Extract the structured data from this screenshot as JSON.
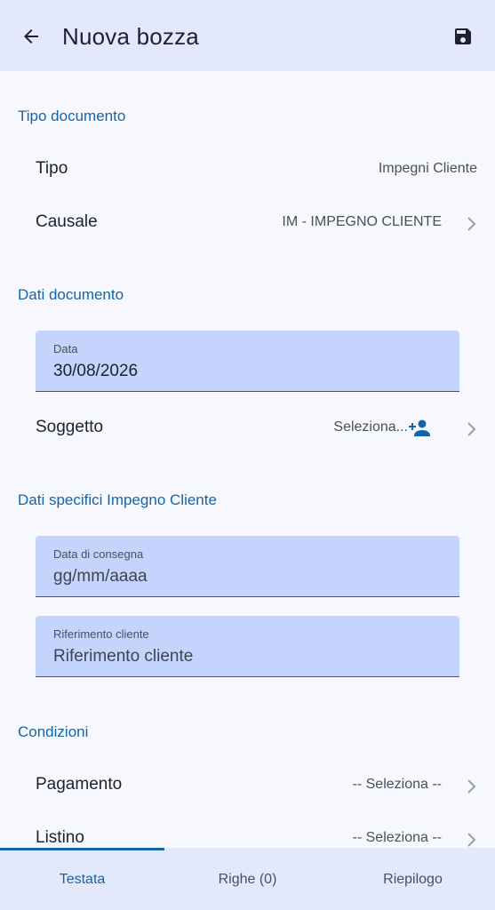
{
  "appbar": {
    "back_icon": "arrow-back-icon",
    "title": "Nuova bozza",
    "save_icon": "save-icon"
  },
  "sections": {
    "tipo_documento": "Tipo documento",
    "dati_documento": "Dati documento",
    "dati_specifici": "Dati specifici Impegno Cliente",
    "condizioni": "Condizioni"
  },
  "rows": {
    "tipo": {
      "label": "Tipo",
      "value": "Impegni Cliente"
    },
    "causale": {
      "label": "Causale",
      "value": "IM - IMPEGNO CLIENTE"
    },
    "soggetto": {
      "label": "Soggetto",
      "value": "Seleziona...",
      "icon": "person-add-icon"
    },
    "pagamento": {
      "label": "Pagamento",
      "value": "-- Seleziona --"
    },
    "listino": {
      "label": "Listino",
      "value": "-- Seleziona --"
    }
  },
  "fields": {
    "data": {
      "label": "Data",
      "value": "30/08/2026"
    },
    "data_consegna": {
      "label": "Data di consegna",
      "placeholder": "gg/mm/aaaa"
    },
    "riferimento": {
      "label": "Riferimento cliente",
      "placeholder": "Riferimento cliente"
    }
  },
  "tabs": [
    {
      "label": "Testata",
      "active": true
    },
    {
      "label": "Righe (0)",
      "active": false
    },
    {
      "label": "Riepilogo",
      "active": false
    }
  ],
  "colors": {
    "accent": "#1565a6",
    "appbar_bg": "#e3e8fb",
    "field_bg": "#c5d4fd"
  }
}
